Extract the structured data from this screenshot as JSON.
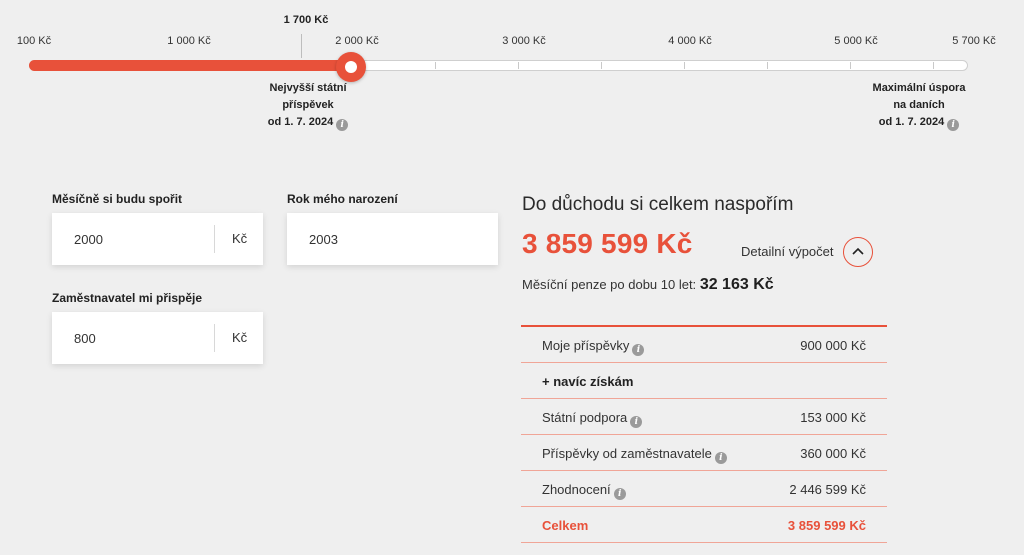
{
  "slider": {
    "ticks": [
      "100 Kč",
      "1 000 Kč",
      "2 000 Kč",
      "3 000 Kč",
      "4 000 Kč",
      "5 000 Kč",
      "5 700 Kč"
    ],
    "marker_label": "1 700 Kč",
    "current_value": 2000,
    "min": 100,
    "max": 5700,
    "note_left": [
      "Nejvyšší státní",
      "příspěvek",
      "od 1. 7. 2024"
    ],
    "note_right": [
      "Maximální úspora",
      "na daních",
      "od 1. 7. 2024"
    ]
  },
  "form": {
    "monthly_label": "Měsíčně si budu spořit",
    "monthly_value": "2000",
    "monthly_unit": "Kč",
    "birth_label": "Rok mého narození",
    "birth_value": "2003",
    "employer_label": "Zaměstnavatel mi přispěje",
    "employer_value": "800",
    "employer_unit": "Kč"
  },
  "result": {
    "title": "Do důchodu si celkem naspořím",
    "total": "3 859 599 Kč",
    "detail_link": "Detailní výpočet",
    "pension_prefix": "Měsíční penze po dobu 10 let:",
    "pension_value": "32 163 Kč",
    "rows": [
      {
        "label": "Moje příspěvky",
        "value": "900 000 Kč"
      },
      {
        "label": "+ navíc získám",
        "value": ""
      },
      {
        "label": "Státní podpora",
        "value": "153 000 Kč"
      },
      {
        "label": "Příspěvky od zaměstnavatele",
        "value": "360 000 Kč"
      },
      {
        "label": "Zhodnocení",
        "value": "2 446 599 Kč"
      },
      {
        "label": "Celkem",
        "value": "3 859 599 Kč"
      }
    ]
  },
  "colors": {
    "accent": "#e8513a",
    "background": "#efefef"
  },
  "icons": {
    "info": "info-icon",
    "chevron": "chevron-up-icon"
  }
}
